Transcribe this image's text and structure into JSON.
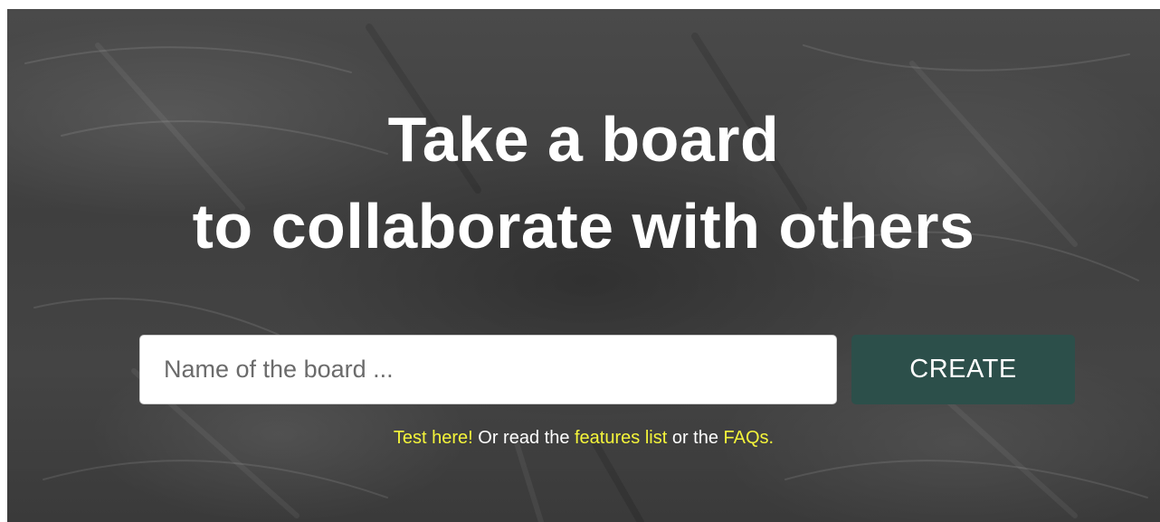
{
  "hero": {
    "headline_line1": "Take a board",
    "headline_line2": "to collaborate with others"
  },
  "form": {
    "board_name_placeholder": "Name of the board ...",
    "board_name_value": "",
    "create_label": "CREATE"
  },
  "links": {
    "test_here": "Test here!",
    "text_or_read": " Or read the ",
    "features_list": "features list",
    "text_or_the": " or the ",
    "faqs": "FAQs."
  },
  "colors": {
    "button_bg": "#2c4f4a",
    "link_color": "#f5f53a",
    "headline_color": "#ffffff"
  }
}
